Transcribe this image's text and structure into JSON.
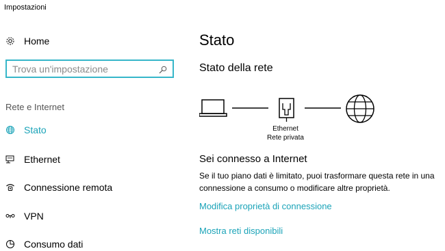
{
  "window": {
    "title": "Impostazioni"
  },
  "sidebar": {
    "home_label": "Home",
    "search_placeholder": "Trova un'impostazione",
    "search_value": "",
    "section_title": "Rete e Internet",
    "items": [
      {
        "label": "Stato",
        "icon": "globe-icon",
        "active": true
      },
      {
        "label": "Ethernet",
        "icon": "ethernet-icon",
        "active": false
      },
      {
        "label": "Connessione remota",
        "icon": "phone-icon",
        "active": false
      },
      {
        "label": "VPN",
        "icon": "vpn-icon",
        "active": false
      },
      {
        "label": "Consumo dati",
        "icon": "data-usage-icon",
        "active": false
      }
    ]
  },
  "main": {
    "title": "Stato",
    "network_status_title": "Stato della rete",
    "diagram": {
      "nodes": [
        "laptop-icon",
        "ethernet-adapter-icon",
        "globe-icon"
      ],
      "adapter_name": "Ethernet",
      "adapter_network": "Rete privata"
    },
    "connected_title": "Sei connesso a Internet",
    "connected_desc": "Se il tuo piano dati è limitato, puoi trasformare questa rete in una connessione a consumo o modificare altre proprietà.",
    "link_change_properties": "Modifica proprietà di connessione",
    "link_show_networks": "Mostra reti disponibili"
  },
  "colors": {
    "accent": "#1aa3b8",
    "search_border": "#35b6c9",
    "text": "#000000",
    "muted": "#555555"
  }
}
